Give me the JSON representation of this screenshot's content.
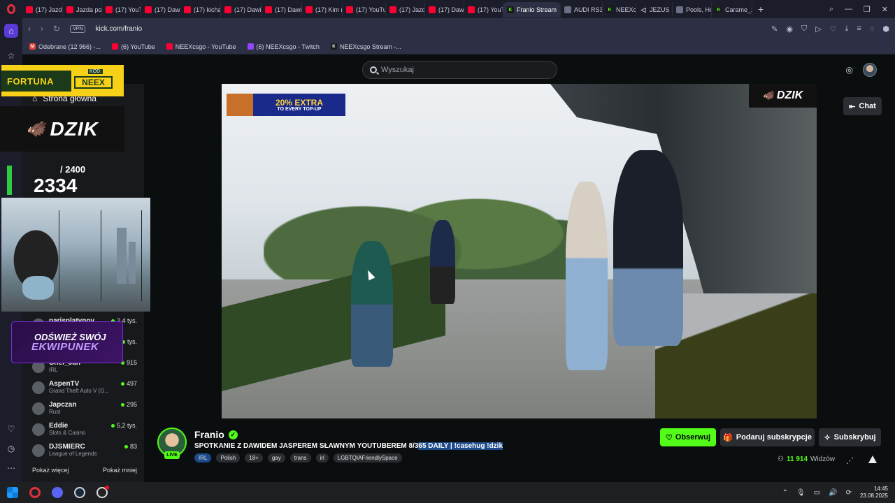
{
  "browser": {
    "tabs": [
      {
        "label": "(17) Jazda",
        "fav": "yt"
      },
      {
        "label": "Jazda po",
        "fav": "yt"
      },
      {
        "label": "(17) YouT",
        "fav": "yt"
      },
      {
        "label": "(17) Dawi",
        "fav": "yt"
      },
      {
        "label": "(17) kichal",
        "fav": "yt"
      },
      {
        "label": "(17) Dawid",
        "fav": "yt"
      },
      {
        "label": "(17) Dawid",
        "fav": "yt"
      },
      {
        "label": "(17) Kim n",
        "fav": "yt"
      },
      {
        "label": "(17) YouTu",
        "fav": "yt"
      },
      {
        "label": "(17) Jazda",
        "fav": "yt"
      },
      {
        "label": "(17) Dawid",
        "fav": "yt"
      },
      {
        "label": "(17) YouTu",
        "fav": "yt"
      },
      {
        "label": "Franio Stream",
        "fav": "kick",
        "active": true
      },
      {
        "label": "AUDI RS3",
        "fav": "gen"
      },
      {
        "label": "NEEXc",
        "fav": "kick"
      },
      {
        "label": "JEZUS",
        "fav": "audio"
      },
      {
        "label": "Pools, Hot",
        "fav": "gen"
      },
      {
        "label": "Carame_2",
        "fav": "kick"
      }
    ],
    "url": "kick.com/franio",
    "vpn_label": "VPN",
    "bookmarks": [
      {
        "label": "Odebrane (12 966) -...",
        "fav": "gmail"
      },
      {
        "label": "(6) YouTube",
        "fav": "yt"
      },
      {
        "label": "NEEXcsgo - YouTube",
        "fav": "yt"
      },
      {
        "label": "(6) NEEXcsgo - Twitch",
        "fav": "twitch"
      },
      {
        "label": "NEEXcsgo Stream -...",
        "fav": "kick"
      }
    ]
  },
  "kick": {
    "search_placeholder": "Wyszukaj",
    "home_label": "Strona główna",
    "chat_button": "Chat",
    "recommended": [
      {
        "name": "parisplatynov",
        "category": "",
        "viewers": "2.4 tys."
      },
      {
        "name": "",
        "category": "",
        "viewers": "tys."
      },
      {
        "name": "Chef_Jan",
        "category": "IRL",
        "viewers": "915"
      },
      {
        "name": "AspenTV",
        "category": "Grand Theft Auto V (G...",
        "viewers": "497"
      },
      {
        "name": "Japczan",
        "category": "Rust",
        "viewers": "295"
      },
      {
        "name": "Eddie",
        "category": "Slots & Casino",
        "viewers": "5,2 tys."
      },
      {
        "name": "DJSMIERC",
        "category": "League of Legends",
        "viewers": "83"
      }
    ],
    "show_more": "Pokaż więcej",
    "show_less": "Pokaż mniej"
  },
  "overlays": {
    "fortuna": "FORTUNA",
    "kod_label": "KOD:",
    "kod_value": "NEEX",
    "dzik": "DZIK",
    "goal_target": "/ 2400",
    "goal_count": "2334",
    "refresh_line1": "ODŚWIEŻ SWÓJ",
    "refresh_line2": "EKWIPUNEK",
    "promo_big": "20% EXTRA",
    "promo_small": "TO EVERY TOP-UP"
  },
  "stream": {
    "name": "Franio",
    "live": "LIVE",
    "title_plain": "SPOTKANIE Z DAWIDEM JASPEREM SŁAWNYM YOUTUBEREM 8/3",
    "title_highlight": "65 DAILY | !casehug !dzik",
    "tags": [
      "IRL",
      "Polish",
      "18+",
      "gay",
      "trans",
      "irl",
      "LGBTQIAFriendlySpace"
    ],
    "follow": "Obserwuj",
    "gift": "Podaruj subskrypcje",
    "subscribe": "Subskrybuj",
    "viewers": "11 914",
    "viewers_label": "Widzów"
  },
  "taskbar": {
    "time": "14:45",
    "date": "23.08.2025"
  }
}
